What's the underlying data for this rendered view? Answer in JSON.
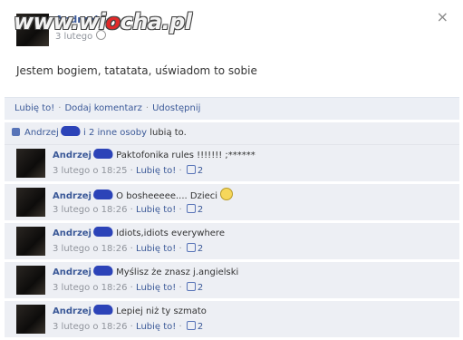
{
  "watermark": {
    "part1": "www.wi",
    "part2": "o",
    "part3": "cha.pl"
  },
  "post": {
    "author": "Andrzej",
    "time": "3 lutego",
    "text": "Jestem bogiem, tatatata, uświadom to sobie",
    "close_glyph": "×"
  },
  "actions": {
    "like": "Lubię to!",
    "sep": "·",
    "comment": "Dodaj komentarz",
    "share": "Udostępnij"
  },
  "likes": {
    "name": "Andrzej",
    "others": "i 2 inne osoby",
    "suffix": "lubią to."
  },
  "comments": [
    {
      "name": "Andrzej",
      "text": "Paktofonika rules !!!!!!! ;******",
      "time": "3 lutego o 18:25",
      "like": "Lubię to!",
      "count": "2",
      "smiley": false
    },
    {
      "name": "Andrzej",
      "text": "O bosheeeee.... Dzieci",
      "time": "3 lutego o 18:26",
      "like": "Lubię to!",
      "count": "2",
      "smiley": true
    },
    {
      "name": "Andrzej",
      "text": "Idiots,idiots everywhere",
      "time": "3 lutego o 18:26",
      "like": "Lubię to!",
      "count": "2",
      "smiley": false
    },
    {
      "name": "Andrzej",
      "text": "Myślisz że znasz j.angielski",
      "time": "3 lutego o 18:26",
      "like": "Lubię to!",
      "count": "2",
      "smiley": false
    },
    {
      "name": "Andrzej",
      "text": "Lepiej niż ty szmato",
      "time": "3 lutego o 18:26",
      "like": "Lubię to!",
      "count": "2",
      "smiley": false
    }
  ]
}
